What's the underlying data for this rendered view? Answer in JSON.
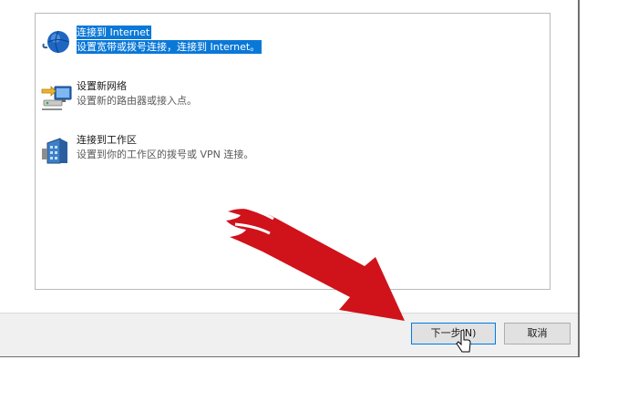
{
  "options": [
    {
      "title": "连接到 Internet",
      "desc": "设置宽带或拨号连接，连接到 Internet。",
      "icon": "globe-icon",
      "selected": true
    },
    {
      "title": "设置新网络",
      "desc": "设置新的路由器或接入点。",
      "icon": "new-network-icon",
      "selected": false
    },
    {
      "title": "连接到工作区",
      "desc": "设置到你的工作区的拨号或 VPN 连接。",
      "icon": "workplace-icon",
      "selected": false
    }
  ],
  "buttons": {
    "next_label": "下一步(N)",
    "cancel_label": "取消"
  },
  "colors": {
    "selection": "#0a78d7",
    "annotation_arrow": "#d0121b"
  }
}
